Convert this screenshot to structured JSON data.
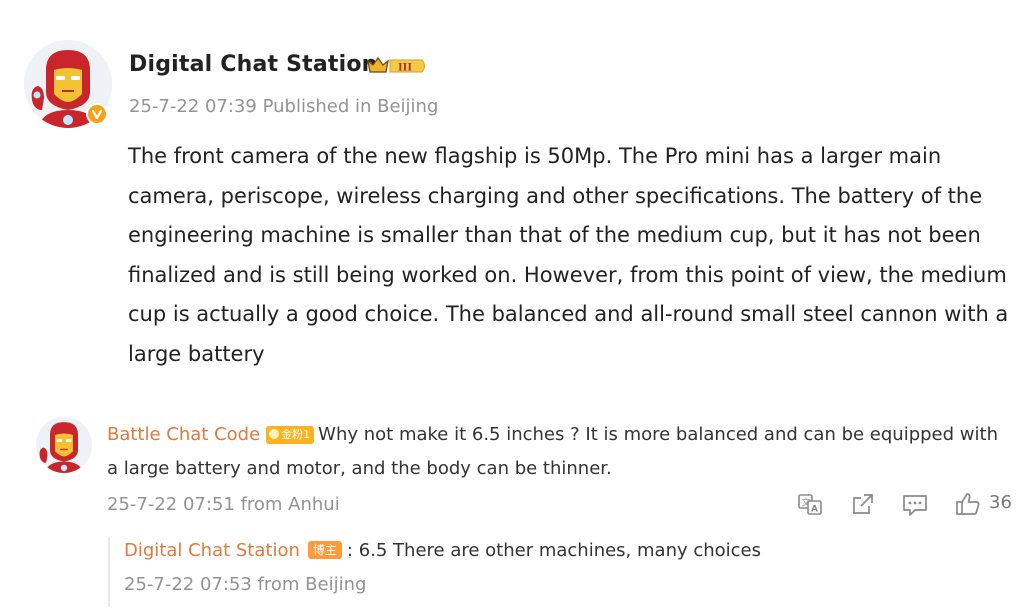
{
  "post": {
    "author": "Digital Chat Station",
    "rank_badge": "III",
    "date": "25-7-22 07:39",
    "location": "Published in Beijing",
    "text": "The front camera of the new flagship is 50Mp. The Pro mini has a larger main camera, periscope, wireless charging and other specifications. The battery of the engineering machine is smaller than that of the medium cup, but it has not been finalized and is still being worked on. However, from this point of view, the medium cup is actually a good choice. The balanced and all-round small steel cannon with a large battery",
    "avatar_icon": "iron-man-avatar",
    "verified_icon": "verified-v-badge"
  },
  "comment": {
    "author": "Battle Chat Code",
    "fan_badge": "金粉1",
    "text": "Why not make it 6.5 inches ? It is more balanced and can be equipped with a large battery and motor, and the body can be thinner.",
    "meta": "25-7-22 07:51 from Anhui",
    "avatar_icon": "iron-man-avatar",
    "actions": {
      "translate_icon": "translate-icon",
      "share_icon": "share-icon",
      "comment_icon": "comment-icon",
      "like_icon": "thumbs-up-icon",
      "like_count": "36"
    }
  },
  "reply": {
    "author": "Digital Chat Station",
    "host_badge": "博主",
    "text": ": 6.5 There are other machines, many choices",
    "meta": "25-7-22 07:53 from Beijing"
  },
  "colors": {
    "accent_name": "#e0793c",
    "meta_gray": "#939393",
    "verified_orange": "#f7a21b",
    "badge_gold": "#ffb21e",
    "host_badge": "#ff9a3c",
    "ironman_red": "#c9262c",
    "ironman_gold": "#f1c232"
  }
}
